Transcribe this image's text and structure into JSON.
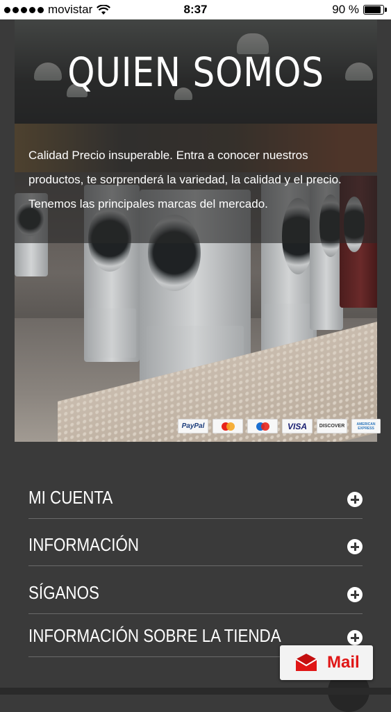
{
  "status_bar": {
    "carrier": "movistar",
    "time": "8:37",
    "battery_percent": "90 %",
    "battery_level": 0.9,
    "signal_dots": 5
  },
  "hero": {
    "title": "QUIEN SOMOS",
    "description": "Calidad Precio insuperable. Entra a conocer nuestros productos, te sorprenderá la variedad, la calidad y el precio. Tenemos las principales marcas del mercado."
  },
  "payments": {
    "paypal": "PayPal",
    "mastercard": "MasterCard",
    "maestro": "Maestro",
    "visa": "VISA",
    "discover": "DISCOVER",
    "amex": "AMERICAN EXPRESS"
  },
  "footer": {
    "items": [
      {
        "label": "MI CUENTA"
      },
      {
        "label": "INFORMACIÓN"
      },
      {
        "label": "SÍGANOS"
      },
      {
        "label": "INFORMACIÓN SOBRE LA TIENDA"
      }
    ]
  },
  "mail_button": {
    "label": "Mail",
    "icon": "envelope-icon"
  },
  "colors": {
    "background": "#3a3a3a",
    "mail_accent": "#e01616"
  }
}
